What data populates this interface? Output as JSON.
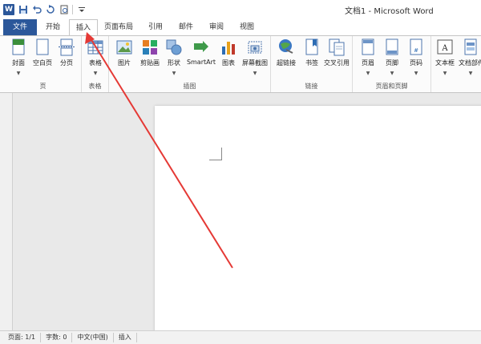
{
  "window": {
    "title": "文档1 - Microsoft Word"
  },
  "qat": {
    "icons": [
      "word-logo",
      "save-icon",
      "undo-icon",
      "redo-icon",
      "print-preview-icon",
      "customize-icon"
    ]
  },
  "tabs": [
    {
      "label": "文件"
    },
    {
      "label": "开始"
    },
    {
      "label": "插入"
    },
    {
      "label": "页面布局"
    },
    {
      "label": "引用"
    },
    {
      "label": "邮件"
    },
    {
      "label": "审阅"
    },
    {
      "label": "视图"
    }
  ],
  "ribbon": {
    "groups": [
      {
        "label": "页",
        "buttons": [
          "封面",
          "空白页",
          "分页"
        ]
      },
      {
        "label": "表格",
        "buttons": [
          "表格"
        ]
      },
      {
        "label": "插图",
        "buttons": [
          "图片",
          "剪贴画",
          "形状",
          "SmartArt",
          "图表",
          "屏幕截图"
        ]
      },
      {
        "label": "链接",
        "buttons": [
          "超链接",
          "书签",
          "交叉引用"
        ]
      },
      {
        "label": "页眉和页脚",
        "buttons": [
          "页眉",
          "页脚",
          "页码"
        ]
      },
      {
        "label": "",
        "buttons": [
          "文本框",
          "文档部件"
        ]
      }
    ]
  },
  "status": {
    "page": "页面: 1/1",
    "words": "字数: 0",
    "language": "中文(中国)",
    "mode": "插入"
  },
  "colors": {
    "accent": "#2b579a",
    "annotation": "#e53935"
  }
}
